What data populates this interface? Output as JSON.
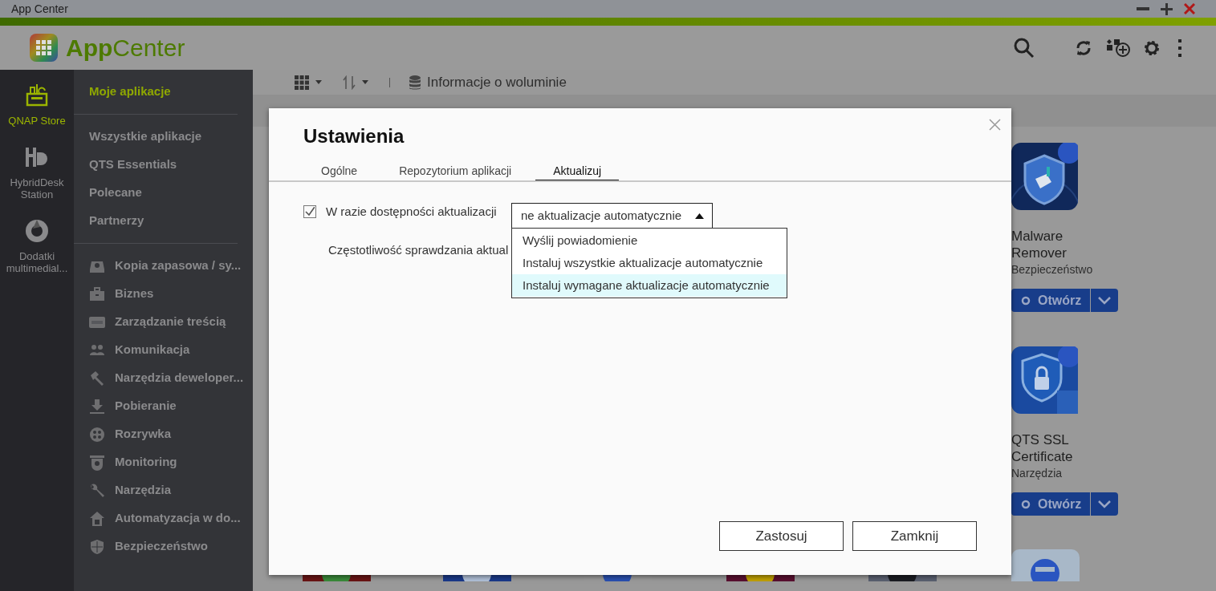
{
  "window": {
    "title": "App Center"
  },
  "header": {
    "app_name": "**App**Center"
  },
  "rail": [
    {
      "label": "QNAP Store",
      "selected": true
    },
    {
      "label": "HybridDesk Station",
      "selected": false
    },
    {
      "label": "Dodatki multimedial...",
      "selected": false
    }
  ],
  "sidebar": {
    "heading": {
      "label": "Moje aplikacje",
      "selected": true
    },
    "items": [
      "Wszystkie aplikacje",
      "QTS Essentials",
      "Polecane",
      "Partnerzy"
    ],
    "categories": [
      "Kopia zapasowa / sy...",
      "Biznes",
      "Zarządzanie treścią",
      "Komunikacja",
      "Narzędzia deweloper...",
      "Pobieranie",
      "Rozrywka",
      "Monitoring",
      "Narzędzia",
      "Automatyzacja w do...",
      "Bezpieczeństwo"
    ]
  },
  "toolbar": {
    "volume_info": "Informacje o woluminie"
  },
  "apps": [
    {
      "name": "Malware Remover",
      "category": "Bezpieczeństwo",
      "button": "Otwórz"
    },
    {
      "name": "QTS SSL Certificate",
      "category": "Narzędzia",
      "button": "Otwórz"
    }
  ],
  "dialog": {
    "title": "Ustawienia",
    "tabs": [
      {
        "label": "Ogólne",
        "selected": false
      },
      {
        "label": "Repozytorium aplikacji",
        "selected": false
      },
      {
        "label": "Aktualizuj",
        "selected": true
      }
    ],
    "auto_update": {
      "label": "W razie dostępności aktualizacji",
      "checked": true,
      "value": "ne aktualizacje automatycznie",
      "expanded": true,
      "options": [
        {
          "label": "Wyślij powiadomienie",
          "selected": false
        },
        {
          "label": "Instaluj wszystkie aktualizacje automatycznie",
          "selected": false
        },
        {
          "label": "Instaluj wymagane aktualizacje automatycznie",
          "selected": true
        }
      ]
    },
    "frequency_label": "Częstotliwość sprawdzania aktual",
    "buttons": [
      "Zastosuj",
      "Zamknij"
    ]
  }
}
